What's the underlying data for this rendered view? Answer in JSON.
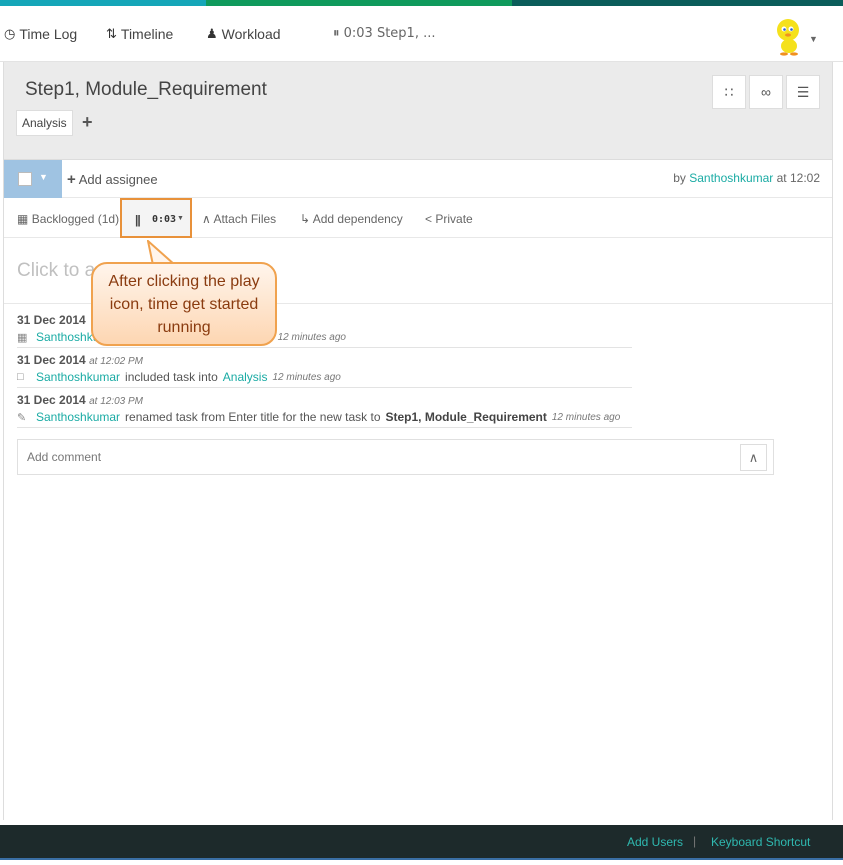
{
  "colors": {
    "topbar": [
      "#15a6b8",
      "#0f9a5c",
      "#0b5d5a"
    ],
    "accent": "#1aaba4",
    "highlight": "#e8913a"
  },
  "nav": {
    "items": [
      {
        "label": "Time Log",
        "icon": "clock-icon"
      },
      {
        "label": "Timeline",
        "icon": "sliders-icon"
      },
      {
        "label": "Workload",
        "icon": "user-icon"
      }
    ],
    "timer_label": "⏸ 0:03 Step1, ..."
  },
  "task": {
    "title": "Step1, Module_Requirement",
    "tag": "Analysis",
    "add_assignee": "Add assignee",
    "by_prefix": "by",
    "author": "Santhoshkumar",
    "at_time": "at 12:02"
  },
  "actions": {
    "backlogged": "Backlogged (1d)",
    "timer": "0:03",
    "attach": "Attach Files",
    "dependency": "Add dependency",
    "private": "Private"
  },
  "description_placeholder": "Click to a",
  "callout": "After clicking the play icon, time get started running",
  "log": [
    {
      "date": "31 Dec 2014",
      "time": "",
      "icon": "calendar-icon",
      "user": "Santhoshku",
      "text": "",
      "ago": "12 minutes ago"
    },
    {
      "date": "31 Dec 2014",
      "time": "at 12:02 PM",
      "icon": "folder-icon",
      "user": "Santhoshkumar",
      "text": "included task into",
      "link": "Analysis",
      "ago": "12 minutes ago"
    },
    {
      "date": "31 Dec 2014",
      "time": "at 12:03 PM",
      "icon": "pencil-icon",
      "user": "Santhoshkumar",
      "text": "renamed task from Enter title for the new task to",
      "bold": "Step1, Module_Requirement",
      "ago": "12 minutes ago"
    }
  ],
  "comment_placeholder": "Add comment",
  "footer": {
    "add_users": "Add Users",
    "separator": "|",
    "shortcut": "Keyboard Shortcut"
  }
}
